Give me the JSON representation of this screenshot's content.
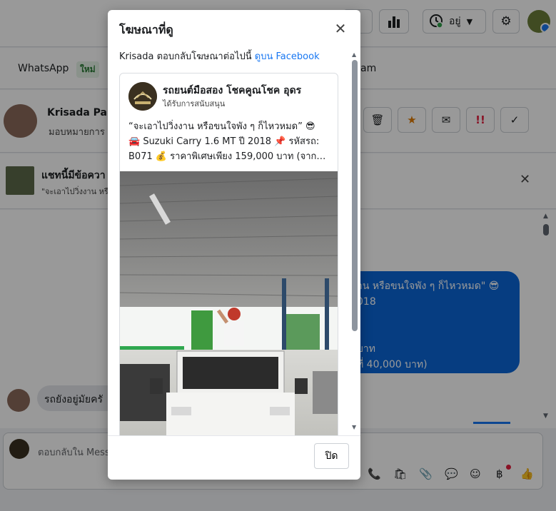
{
  "header": {
    "status_label": "อยู่"
  },
  "tabs": [
    {
      "label": "WhatsApp",
      "badge": "ใหม่"
    },
    {
      "label": "am"
    }
  ],
  "conversation": {
    "contact_name": "Krisada Pan",
    "assign_text": "มอบหมายการ"
  },
  "ad_banner": {
    "title": "แชทนี้มีข้อควา",
    "preview": "\"จะเอาไปวิ่งงาน หรื"
  },
  "messages": {
    "blue_lines": [
      "าน หรือขนใจพัง ๆ ก็ไหวหมด\" 😎",
      "018",
      "",
      "",
      "บาท",
      "ที่ 40,000 บาท)"
    ],
    "grey_text": "รถยังอยู่มัยครั"
  },
  "composer": {
    "placeholder": "ตอบกลับใน Mess"
  },
  "modal": {
    "title": "โฆษณาที่ดู",
    "subtitle_prefix": "Krisada ตอบกลับโฆษณาต่อไปนี้",
    "subtitle_link": "ดูบน Facebook",
    "page_name": "รถยนต์มือสอง โชคคูณโชค อุดร",
    "sponsored_label": "ได้รับการสนับสนุน",
    "ad_text_line1": "“จะเอาไปวิ่งงาน หรือขนใจพัง ๆ ก็ไหวหมด” 😎",
    "ad_text_line2": "🚘 Suzuki Carry 1.6 MT ปี 2018 📌 รหัสรถ:",
    "ad_text_line3": "B071 💰 ราคาพิเศษเพียง 159,000 บาท (จาก…",
    "close_button": "ปิด"
  },
  "colors": {
    "accent": "#0a66d8",
    "link": "#1877f2"
  }
}
